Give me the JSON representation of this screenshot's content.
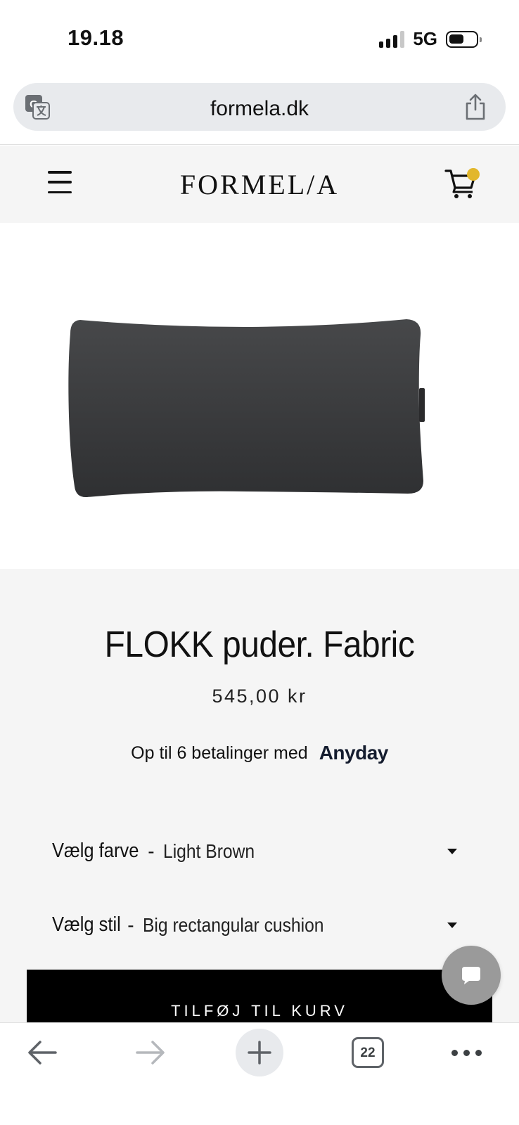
{
  "status_bar": {
    "time": "19.18",
    "network": "5G",
    "battery_level": 0.55
  },
  "browser": {
    "url": "formela.dk",
    "tab_count": "22",
    "icons": {
      "translate": "translate-icon",
      "share": "share-icon",
      "back": "arrow-left-icon",
      "forward": "arrow-right-icon",
      "new_tab": "plus-icon",
      "more": "more-horizontal-icon"
    }
  },
  "site": {
    "logo": "FORMEL/A",
    "cart_indicator_color": "#e2b72c"
  },
  "product": {
    "title": "FLOKK puder. Fabric",
    "price": "545,00 kr",
    "installments_text": "Op til 6 betalinger med",
    "installments_provider": "Anyday",
    "options": {
      "color_label": "Vælg farve",
      "color_value": "Light Brown",
      "style_label": "Vælg stil",
      "style_value": "Big rectangular cushion",
      "separator": "-"
    },
    "add_to_cart_label": "TILFØJ TIL KURV"
  },
  "colors": {
    "page_bg": "#f5f5f5",
    "button_bg": "#000000",
    "chat_button": "#9a9a9a",
    "pillow": "#3a3b3d"
  }
}
